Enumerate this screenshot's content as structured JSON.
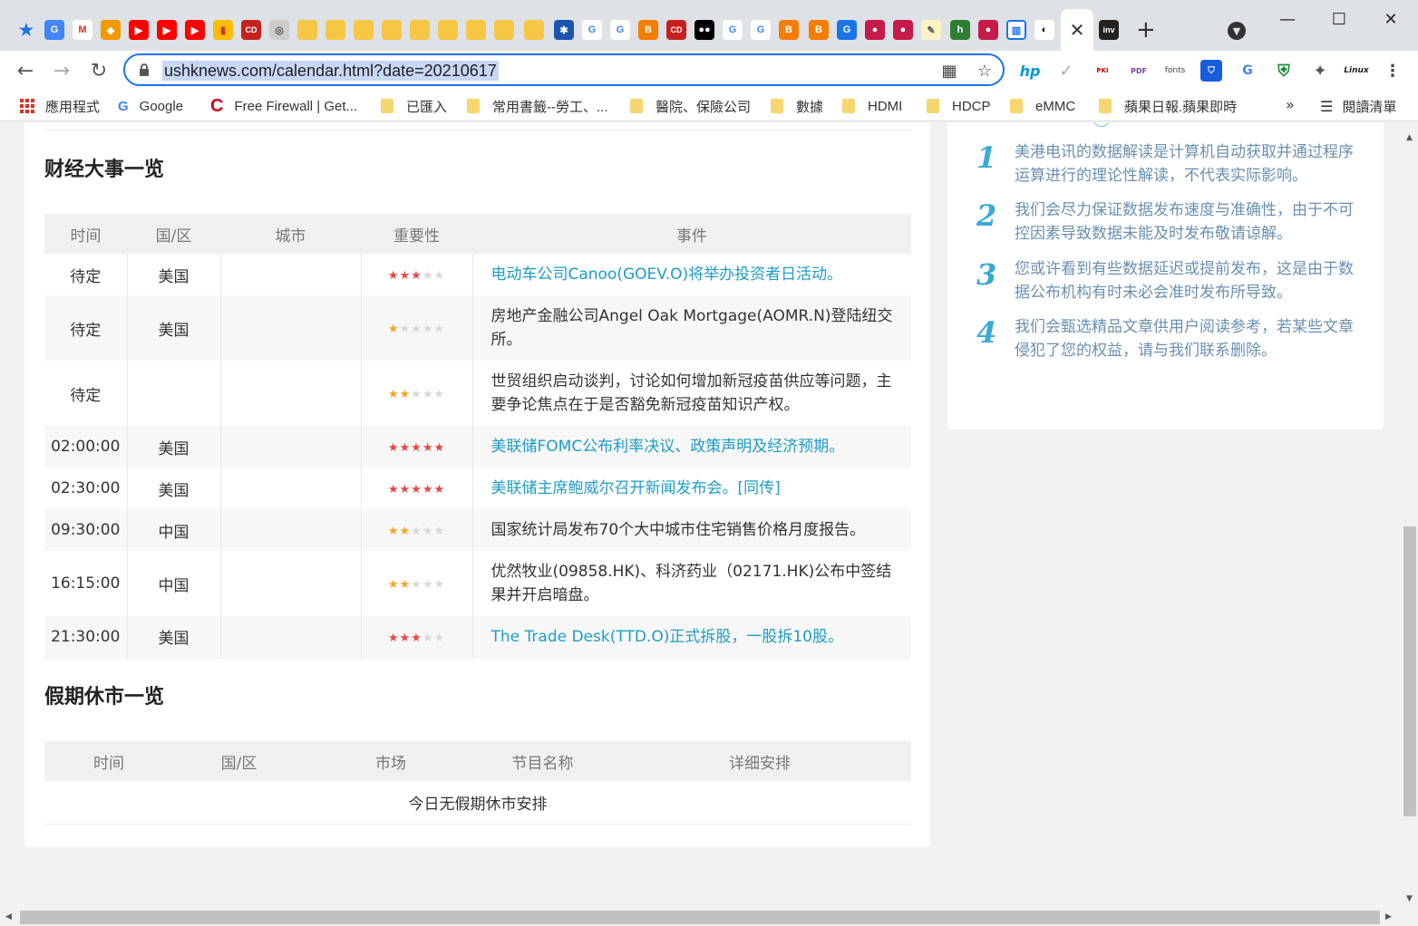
{
  "browser": {
    "url": "ushknews.com/calendar.html?date=20210617",
    "bookmarks": [
      {
        "label": "應用程式"
      },
      {
        "label": "Google"
      },
      {
        "label": "Free Firewall | Get..."
      },
      {
        "label": "已匯入"
      },
      {
        "label": "常用書籤--勞工、..."
      },
      {
        "label": "醫院、保險公司"
      },
      {
        "label": "數據"
      },
      {
        "label": "HDMI"
      },
      {
        "label": "HDCP"
      },
      {
        "label": "eMMC"
      },
      {
        "label": "蘋果日報.蘋果即時"
      }
    ],
    "reading_list": "閱讀清單"
  },
  "events": {
    "title": "财经大事一览",
    "headers": [
      "时间",
      "国/区",
      "城市",
      "重要性",
      "事件"
    ],
    "rows": [
      {
        "time": "待定",
        "region": "美国",
        "city": "",
        "stars": 3,
        "star_color": "#e84646",
        "event": "电动车公司Canoo(GOEV.O)将举办投资者日活动。",
        "link": true
      },
      {
        "time": "待定",
        "region": "美国",
        "city": "",
        "stars": 1,
        "star_color": "#f7a321",
        "event": "房地产金融公司Angel Oak Mortgage(AOMR.N)登陆纽交所。",
        "link": false
      },
      {
        "time": "待定",
        "region": "",
        "city": "",
        "stars": 2,
        "star_color": "#f7a321",
        "event": "世贸组织启动谈判，讨论如何增加新冠疫苗供应等问题，主要争论焦点在于是否豁免新冠疫苗知识产权。",
        "link": false
      },
      {
        "time": "02:00:00",
        "region": "美国",
        "city": "",
        "stars": 5,
        "star_color": "#e84646",
        "event": "美联储FOMC公布利率决议、政策声明及经济预期。",
        "link": true
      },
      {
        "time": "02:30:00",
        "region": "美国",
        "city": "",
        "stars": 5,
        "star_color": "#e84646",
        "event": "美联储主席鲍威尔召开新闻发布会。[同传]",
        "link": true
      },
      {
        "time": "09:30:00",
        "region": "中国",
        "city": "",
        "stars": 2,
        "star_color": "#f7a321",
        "event": "国家统计局发布70个大中城市住宅销售价格月度报告。",
        "link": false
      },
      {
        "time": "16:15:00",
        "region": "中国",
        "city": "",
        "stars": 2,
        "star_color": "#f7a321",
        "event": "优然牧业(09858.HK)、科济药业（02171.HK)公布中签结果并开启暗盘。",
        "link": false
      },
      {
        "time": "21:30:00",
        "region": "美国",
        "city": "",
        "stars": 3,
        "star_color": "#e84646",
        "event": "The Trade Desk(TTD.O)正式拆股，一股拆10股。",
        "link": true
      }
    ]
  },
  "holidays": {
    "title": "假期休市一览",
    "headers": [
      "时间",
      "国/区",
      "市场",
      "节目名称",
      "详细安排"
    ],
    "empty_text": "今日无假期休市安排"
  },
  "disclaimer": {
    "items": [
      {
        "num": "1",
        "text": "美港电讯的数据解读是计算机自动获取并通过程序运算进行的理论性解读，不代表实际影响。"
      },
      {
        "num": "2",
        "text": "我们会尽力保证数据发布速度与准确性，由于不可控因素导致数据未能及时发布敬请谅解。"
      },
      {
        "num": "3",
        "text": "您或许看到有些数据延迟或提前发布，这是由于数据公布机构有时未必会准时发布所导致。"
      },
      {
        "num": "4",
        "text": "我们会甄选精品文章供用户阅读参考，若某些文章侵犯了您的权益，请与我们联系删除。"
      }
    ]
  },
  "colors": {
    "accent": "#1a73e8",
    "link": "#1e9cc5",
    "star_red": "#e84646",
    "star_gold": "#f7a321"
  }
}
